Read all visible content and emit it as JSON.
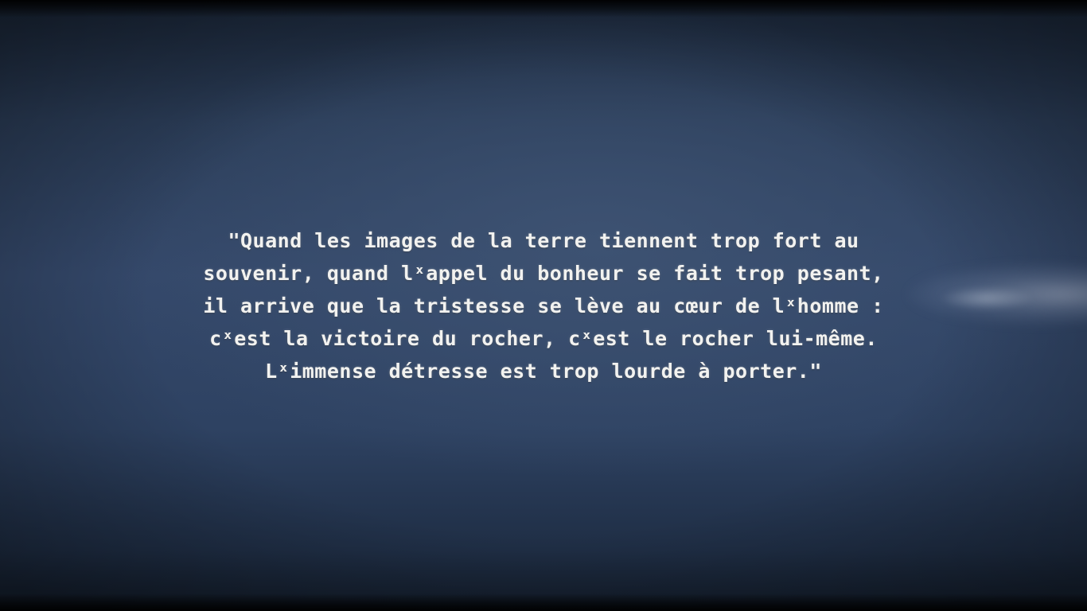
{
  "quote": {
    "lines": [
      "\"Quand les images de la terre tiennent trop fort au",
      "souvenir, quand lˣappel du bonheur se fait trop pesant,",
      "il arrive que la tristesse se lève au cœur de lˣhomme :",
      "cˣest la victoire du rocher, cˣest le rocher lui-même.",
      "Lˣimmense détresse est trop lourde à porter.\""
    ]
  },
  "colors": {
    "text": "#f2f2f0",
    "sky_top": "#1a2638",
    "sky_mid": "#34486a",
    "sky_bottom": "#121b28"
  }
}
